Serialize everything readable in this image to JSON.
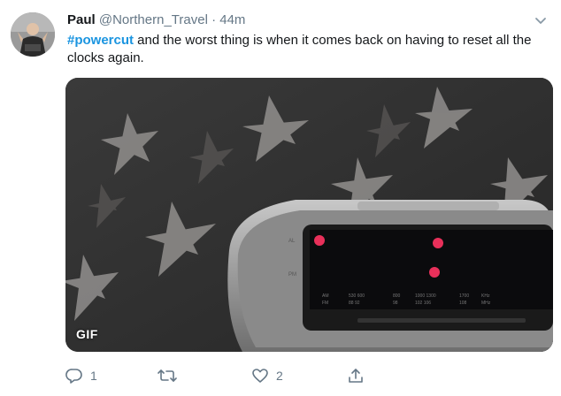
{
  "author": {
    "display_name": "Paul",
    "handle": "@Northern_Travel",
    "separator": "·",
    "time": "44m",
    "avatar_icon": "profile-avatar"
  },
  "tweet": {
    "hashtag": "#powercut",
    "text": " and the worst thing is when it comes back on having to reset all the clocks again."
  },
  "media": {
    "badge": "GIF",
    "content": "radio-clock-gif"
  },
  "actions": {
    "reply_icon": "reply-icon",
    "reply_count": "1",
    "retweet_icon": "retweet-icon",
    "retweet_count": "",
    "like_icon": "heart-icon",
    "like_count": "2",
    "share_icon": "share-icon"
  },
  "colors": {
    "hashtag": "#1b95e0",
    "secondary_text": "#657786",
    "primary_text": "#14171a",
    "led_red": "#e8305a"
  }
}
